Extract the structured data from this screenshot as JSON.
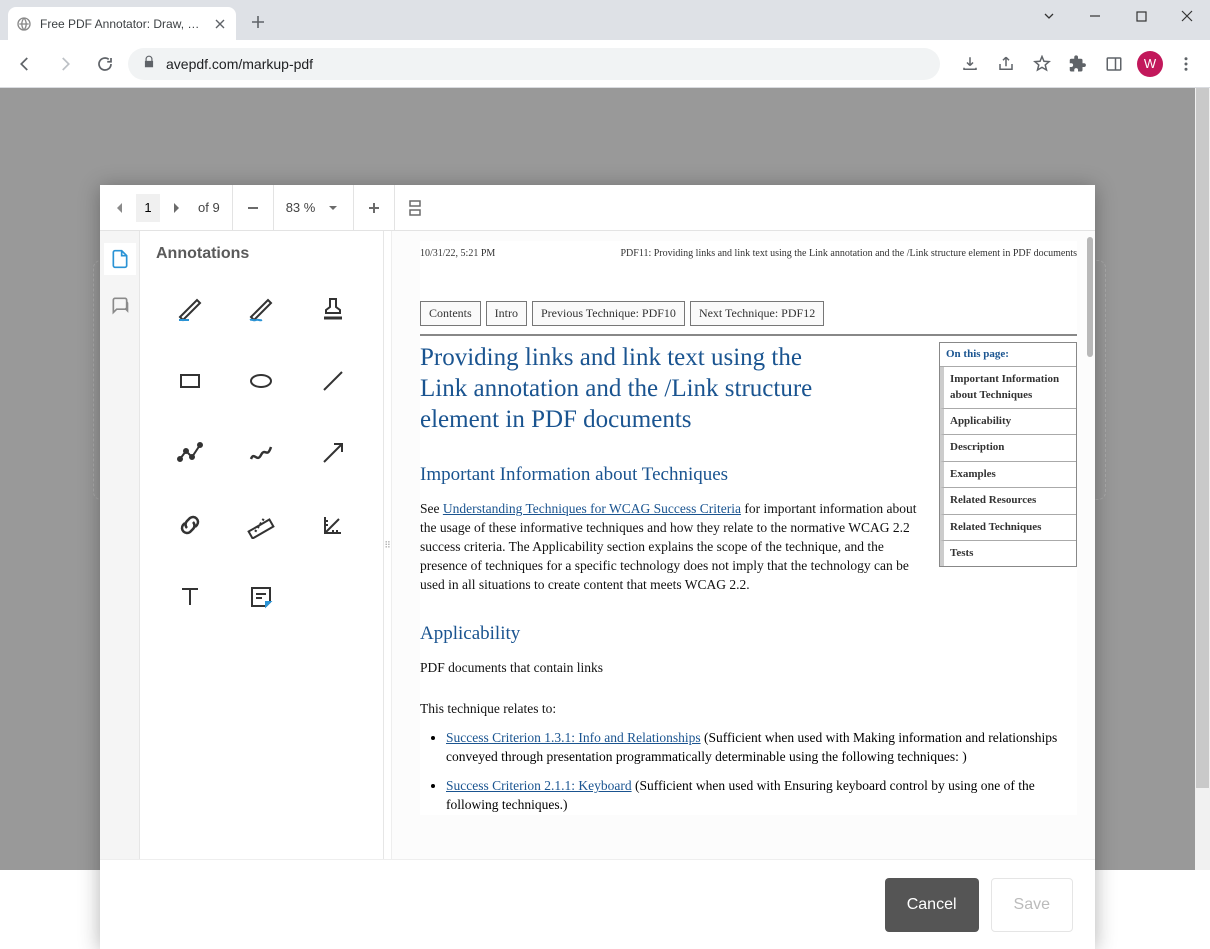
{
  "browser": {
    "tab_title": "Free PDF Annotator: Draw, Hig",
    "url": "avepdf.com/markup-pdf",
    "avatar_letter": "W"
  },
  "toolbar": {
    "page_current": "1",
    "page_of_label": "of 9",
    "zoom": "83 %"
  },
  "panel": {
    "title": "Annotations"
  },
  "doc": {
    "timestamp": "10/31/22, 5:21 PM",
    "header_title": "PDF11: Providing links and link text using the Link annotation and the /Link structure element in PDF documents",
    "nav": [
      "Contents",
      "Intro",
      "Previous Technique: PDF10",
      "Next Technique: PDF12"
    ],
    "h1": "Providing links and link text using the Link annotation and the /Link structure element in PDF documents",
    "sidebox_title": "On this page:",
    "sidebox_items": [
      "Important Information about Techniques",
      "Applicability",
      "Description",
      "Examples",
      "Related Resources",
      "Related Techniques",
      "Tests"
    ],
    "h2_important": "Important Information about Techniques",
    "p_see": "See ",
    "link_understanding": "Understanding Techniques for WCAG Success Criteria",
    "p_important_rest": " for important information about the usage of these informative techniques and how they relate to the normative WCAG 2.2 success criteria. The Applicability section explains the scope of the technique, and the presence of techniques for a specific technology does not imply that the technology can be used in all situations to create content that meets WCAG 2.2.",
    "h2_applicability": "Applicability",
    "p_applicability": "PDF documents that contain links",
    "p_relates": "This technique relates to:",
    "link_sc131": "Success Criterion 1.3.1: Info and Relationships",
    "li_sc131_rest": " (Sufficient when used with Making information and relationships conveyed through presentation programmatically determinable using the following techniques: )",
    "link_sc211": "Success Criterion 2.1.1: Keyboard",
    "li_sc211_rest": " (Sufficient when used with Ensuring keyboard control by using one of the following techniques.)"
  },
  "footer": {
    "cancel": "Cancel",
    "save": "Save"
  }
}
